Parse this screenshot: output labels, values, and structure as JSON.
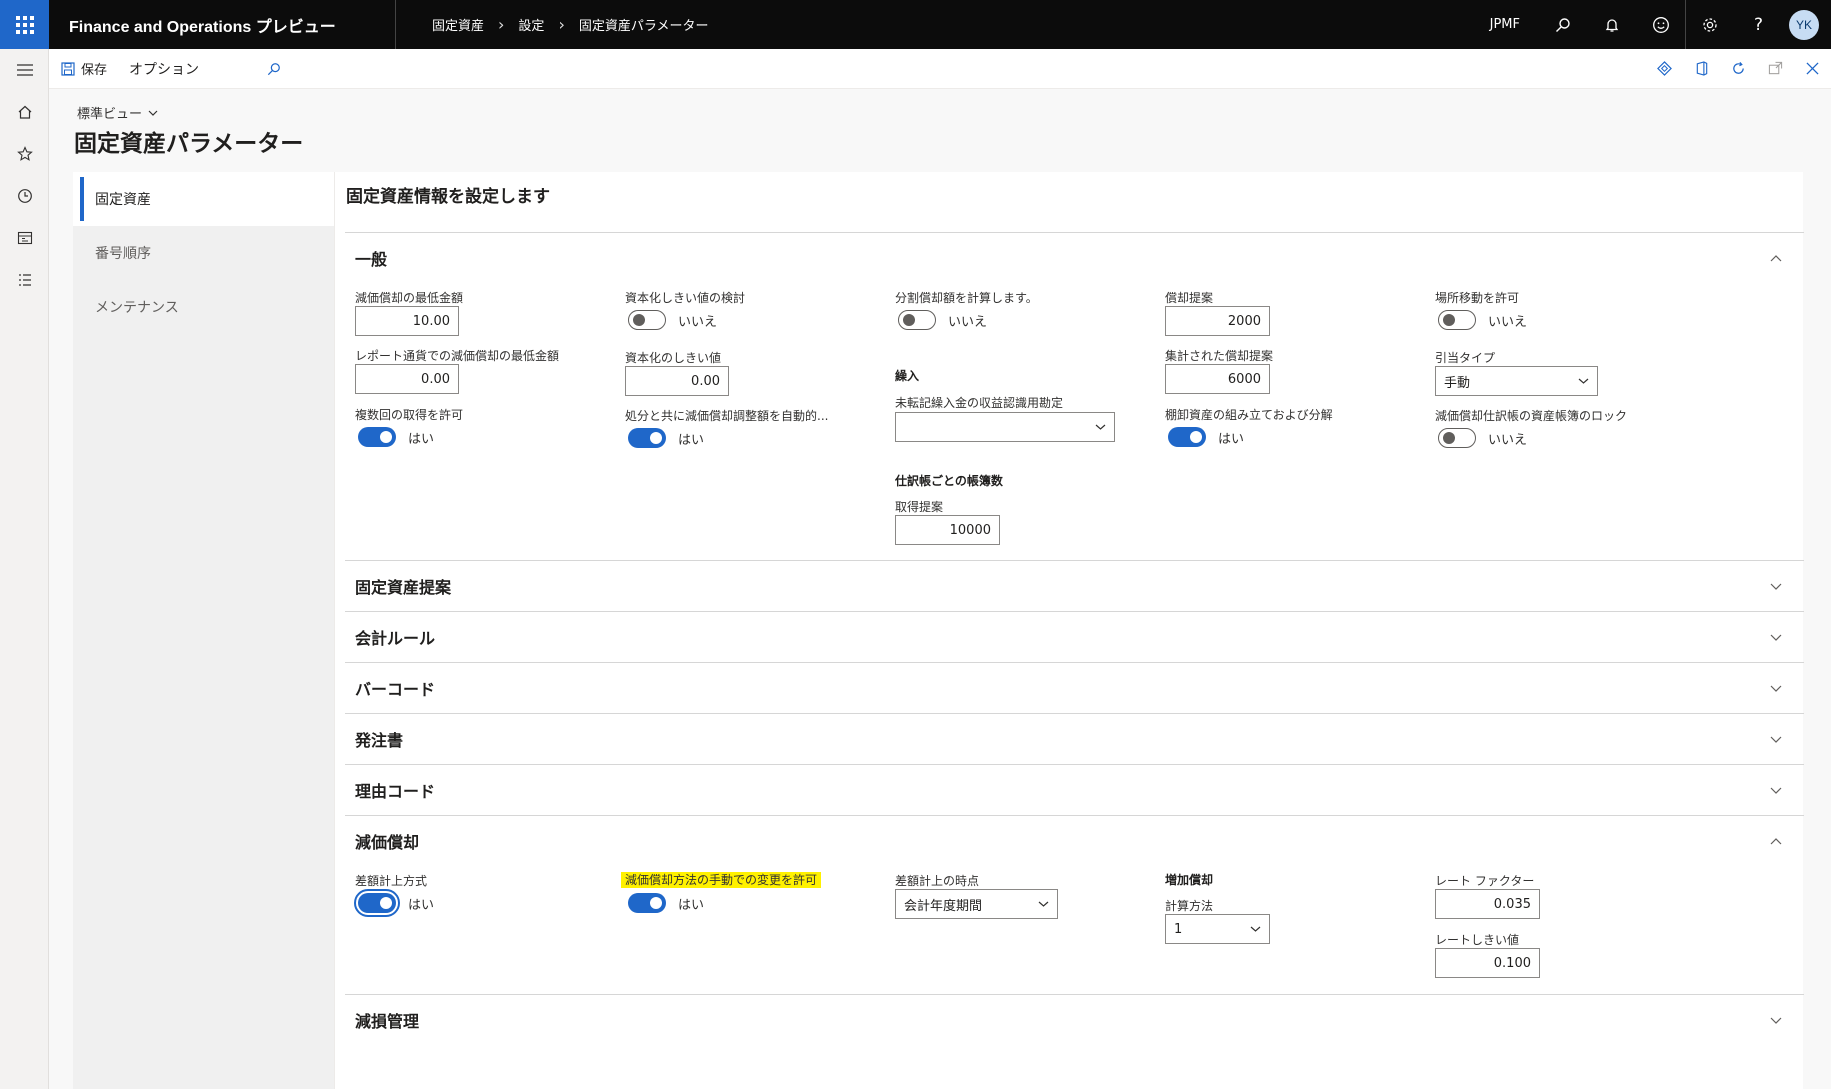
{
  "app": {
    "title": "Finance and Operations プレビュー"
  },
  "breadcrumb": [
    "固定資産",
    "設定",
    "固定資産パラメーター"
  ],
  "topbar": {
    "company": "JPMF",
    "avatar": "YK"
  },
  "toolbar": {
    "save": "保存",
    "options": "オプション"
  },
  "header": {
    "view": "標準ビュー",
    "title": "固定資産パラメーター"
  },
  "tabs": [
    "固定資産",
    "番号順序",
    "メンテナンス"
  ],
  "panel": {
    "title": "固定資産情報を設定します"
  },
  "sections": {
    "general": "一般",
    "proposals": "固定資産提案",
    "accounting": "会計ルール",
    "barcode": "バーコード",
    "po": "発注書",
    "reason": "理由コード",
    "depreciation": "減価償却",
    "impairment": "減損管理"
  },
  "general": {
    "min_dep": {
      "label": "減価償却の最低金額",
      "value": "10.00"
    },
    "min_dep_rep": {
      "label": "レポート通貨での減価償却の最低金額",
      "value": "0.00"
    },
    "multi_acq": {
      "label": "複数回の取得を許可",
      "state": "はい"
    },
    "cap_check": {
      "label": "資本化しきい値の検討",
      "state": "いいえ"
    },
    "cap_threshold": {
      "label": "資本化のしきい値",
      "value": "0.00"
    },
    "disposal_adj": {
      "label": "処分と共に減価償却調整額を自動的...",
      "state": "はい"
    },
    "split_dep": {
      "label": "分割償却額を計算します。",
      "state": "いいえ"
    },
    "transfer_group": "繰入",
    "unposted_account": {
      "label": "未転記繰入金の収益認識用勘定",
      "value": ""
    },
    "journal_group": "仕訳帳ごとの帳簿数",
    "acq_proposal": {
      "label": "取得提案",
      "value": "10000"
    },
    "dep_proposal": {
      "label": "償却提案",
      "value": "2000"
    },
    "summarized_dep": {
      "label": "集計された償却提案",
      "value": "6000"
    },
    "inventory_assembly": {
      "label": "棚卸資産の組み立ておよび分解",
      "state": "はい"
    },
    "allow_transfer": {
      "label": "場所移動を許可",
      "state": "いいえ"
    },
    "allocation_type": {
      "label": "引当タイプ",
      "value": "手動"
    },
    "lock_books": {
      "label": "減価償却仕訳帳の資産帳簿のロック",
      "state": "いいえ"
    }
  },
  "depreciation": {
    "difference_method": {
      "label": "差額計上方式",
      "state": "はい"
    },
    "manual_change": {
      "label": "減価償却方法の手動での変更を許可",
      "state": "はい"
    },
    "difference_timing": {
      "label": "差額計上の時点",
      "value": "会計年度期間"
    },
    "bonus_group": "増加償却",
    "calc_method": {
      "label": "計算方法",
      "value": "1"
    },
    "rate_factor": {
      "label": "レート ファクター",
      "value": "0.035"
    },
    "rate_threshold": {
      "label": "レートしきい値",
      "value": "0.100"
    }
  }
}
